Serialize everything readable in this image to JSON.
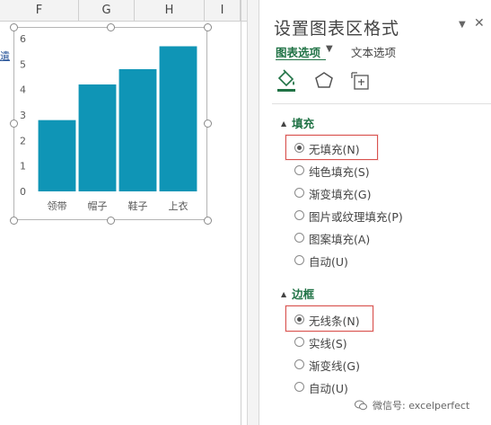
{
  "spreadsheet": {
    "columns": [
      "F",
      "G",
      "H",
      "I"
    ],
    "row_stub": "遺"
  },
  "chart_data": {
    "type": "bar",
    "categories": [
      "领带",
      "帽子",
      "鞋子",
      "上衣"
    ],
    "values": [
      2.8,
      4.2,
      4.8,
      5.7
    ],
    "yticks": [
      "0",
      "1",
      "2",
      "3",
      "4",
      "5",
      "6"
    ],
    "ylim": [
      0,
      6
    ],
    "bar_color": "#0f95b6",
    "grid": false
  },
  "pane": {
    "title": "设置图表区格式",
    "tabs": {
      "chart_options": "图表选项",
      "text_options": "文本选项"
    },
    "fill": {
      "header": "填充",
      "options": [
        {
          "label": "无填充(N)",
          "checked": true
        },
        {
          "label": "纯色填充(S)",
          "checked": false
        },
        {
          "label": "渐变填充(G)",
          "checked": false
        },
        {
          "label": "图片或纹理填充(P)",
          "checked": false
        },
        {
          "label": "图案填充(A)",
          "checked": false
        },
        {
          "label": "自动(U)",
          "checked": false
        }
      ]
    },
    "border": {
      "header": "边框",
      "options": [
        {
          "label": "无线条(N)",
          "checked": true
        },
        {
          "label": "实线(S)",
          "checked": false
        },
        {
          "label": "渐变线(G)",
          "checked": false
        },
        {
          "label": "自动(U)",
          "checked": false
        }
      ]
    },
    "icons": [
      "fill-bucket-icon",
      "pentagon-icon",
      "size-properties-icon"
    ]
  },
  "watermark": "微信号: excelperfect",
  "colors": {
    "accent_green": "#217346",
    "highlight_red": "#d9534f"
  }
}
